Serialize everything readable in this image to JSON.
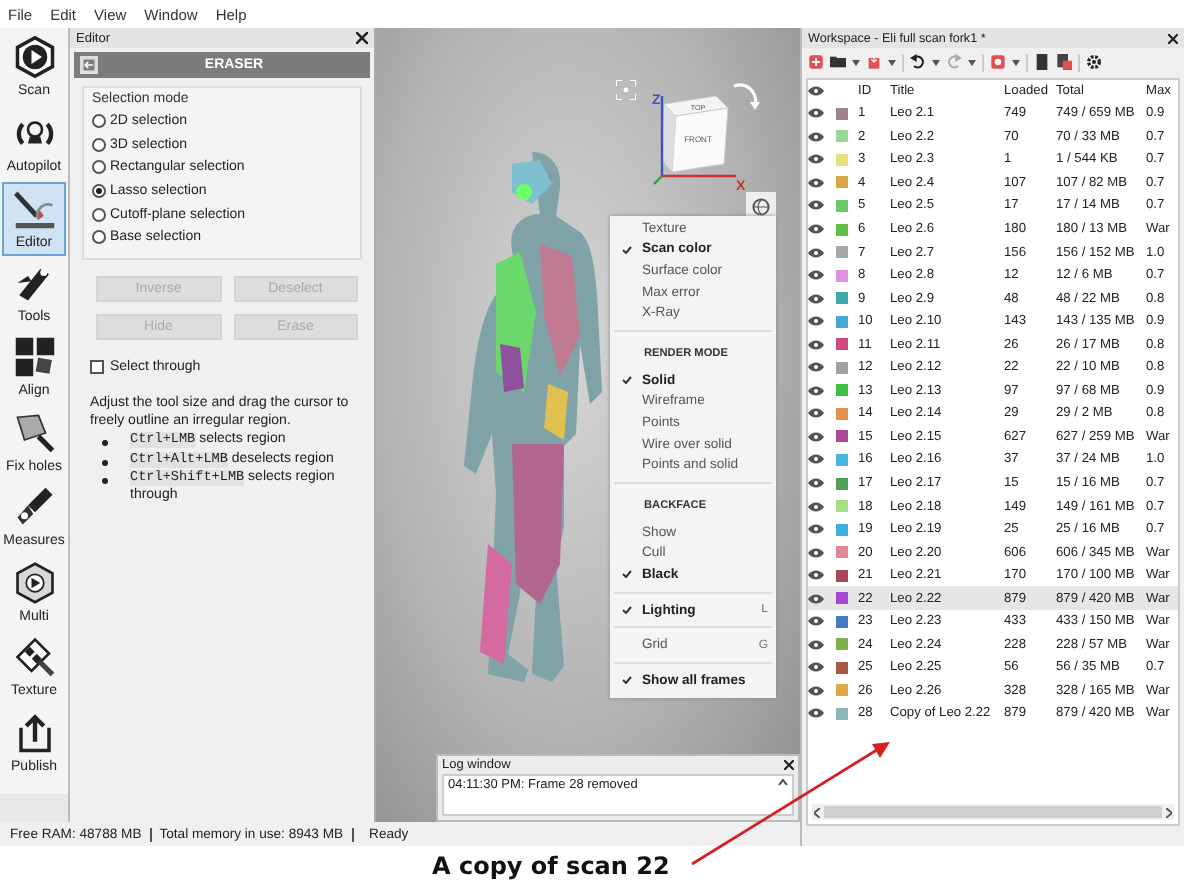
{
  "menu_bar": [
    "File",
    "Edit",
    "View",
    "Window",
    "Help"
  ],
  "tools": [
    {
      "label": "Scan",
      "selected": false
    },
    {
      "label": "Autopilot",
      "selected": false
    },
    {
      "label": "Editor",
      "selected": true
    },
    {
      "label": "Tools",
      "selected": false
    },
    {
      "label": "Align",
      "selected": false
    },
    {
      "label": "Fix holes",
      "selected": false
    },
    {
      "label": "Measures",
      "selected": false
    },
    {
      "label": "Multi",
      "selected": false
    },
    {
      "label": "Texture",
      "selected": false
    },
    {
      "label": "Publish",
      "selected": false
    }
  ],
  "editor": {
    "title": "Editor",
    "header": "ERASER",
    "selection_mode": {
      "title": "Selection mode",
      "options": [
        {
          "label": "2D selection",
          "selected": false
        },
        {
          "label": "3D selection",
          "selected": false
        },
        {
          "label": "Rectangular selection",
          "selected": false
        },
        {
          "label": "Lasso selection",
          "selected": true
        },
        {
          "label": "Cutoff-plane selection",
          "selected": false
        },
        {
          "label": "Base selection",
          "selected": false
        }
      ]
    },
    "buttons": [
      {
        "label": "Inverse",
        "disabled": true
      },
      {
        "label": "Deselect",
        "disabled": true
      },
      {
        "label": "Hide",
        "disabled": true
      },
      {
        "label": "Erase",
        "disabled": true
      }
    ],
    "select_through": {
      "label": "Select through",
      "checked": false
    },
    "description": "Adjust the tool size and drag the cursor to freely outline an irregular region.",
    "shortcuts": [
      {
        "keys": "Ctrl+LMB",
        "text": "selects region"
      },
      {
        "keys": "Ctrl+Alt+LMB",
        "text": "deselects region"
      },
      {
        "keys": "Ctrl+Shift+LMB",
        "text": "selects region through"
      }
    ]
  },
  "viewport": {
    "view_cube": {
      "top": "TOP",
      "front": "FRONT",
      "z_axis": "Z",
      "x_axis": "X"
    },
    "menu": [
      {
        "kind": "item",
        "label": "Texture",
        "checked": false
      },
      {
        "kind": "item",
        "label": "Scan color",
        "checked": true
      },
      {
        "kind": "item",
        "label": "Surface color",
        "checked": false
      },
      {
        "kind": "item",
        "label": "Max error",
        "checked": false
      },
      {
        "kind": "item",
        "label": "X-Ray",
        "checked": false
      },
      {
        "kind": "separator"
      },
      {
        "kind": "header",
        "label": "RENDER MODE"
      },
      {
        "kind": "item",
        "label": "Solid",
        "checked": true
      },
      {
        "kind": "item",
        "label": "Wireframe",
        "checked": false
      },
      {
        "kind": "item",
        "label": "Points",
        "checked": false
      },
      {
        "kind": "item",
        "label": "Wire over solid",
        "checked": false
      },
      {
        "kind": "item",
        "label": "Points and solid",
        "checked": false
      },
      {
        "kind": "separator"
      },
      {
        "kind": "header",
        "label": "BACKFACE"
      },
      {
        "kind": "item",
        "label": "Show",
        "checked": false
      },
      {
        "kind": "item",
        "label": "Cull",
        "checked": false
      },
      {
        "kind": "item",
        "label": "Black",
        "checked": true
      },
      {
        "kind": "separator"
      },
      {
        "kind": "item",
        "label": "Lighting",
        "checked": true,
        "shortcut": "L"
      },
      {
        "kind": "separator"
      },
      {
        "kind": "item",
        "label": "Grid",
        "checked": false,
        "shortcut": "G"
      },
      {
        "kind": "separator"
      },
      {
        "kind": "item",
        "label": "Show all frames",
        "checked": true
      }
    ]
  },
  "log_window": {
    "title": "Log window",
    "lines": [
      "04:11:30 PM: Frame 28 removed"
    ]
  },
  "workspace": {
    "title": "Workspace - Eli full scan fork1 *",
    "columns": [
      "ID",
      "Title",
      "Loaded",
      "Total",
      "Max"
    ],
    "rows": [
      {
        "id": "1",
        "title": "Leo 2.1",
        "loaded": "749",
        "total": "749 / 659 MB",
        "max": "0.9",
        "color": "#a08488",
        "selected": false
      },
      {
        "id": "2",
        "title": "Leo 2.2",
        "loaded": "70",
        "total": "70 / 33 MB",
        "max": "0.7",
        "color": "#98d898",
        "selected": false
      },
      {
        "id": "3",
        "title": "Leo 2.3",
        "loaded": "1",
        "total": "1 / 544 KB",
        "max": "0.7",
        "color": "#e8e080",
        "selected": false
      },
      {
        "id": "4",
        "title": "Leo 2.4",
        "loaded": "107",
        "total": "107 / 82 MB",
        "max": "0.7",
        "color": "#d8a848",
        "selected": false
      },
      {
        "id": "5",
        "title": "Leo 2.5",
        "loaded": "17",
        "total": "17 / 14 MB",
        "max": "0.7",
        "color": "#68c868",
        "selected": false
      },
      {
        "id": "6",
        "title": "Leo 2.6",
        "loaded": "180",
        "total": "180 / 13 MB",
        "max": "War",
        "color": "#60c048",
        "selected": false
      },
      {
        "id": "7",
        "title": "Leo 2.7",
        "loaded": "156",
        "total": "156 / 152 MB",
        "max": "1.0",
        "color": "#a8a8a8",
        "selected": false
      },
      {
        "id": "8",
        "title": "Leo 2.8",
        "loaded": "12",
        "total": "12 / 6 MB",
        "max": "0.7",
        "color": "#e090e0",
        "selected": false
      },
      {
        "id": "9",
        "title": "Leo 2.9",
        "loaded": "48",
        "total": "48 / 22 MB",
        "max": "0.8",
        "color": "#40a8a8",
        "selected": false
      },
      {
        "id": "10",
        "title": "Leo 2.10",
        "loaded": "143",
        "total": "143 / 135 MB",
        "max": "0.9",
        "color": "#48a8d8",
        "selected": false
      },
      {
        "id": "11",
        "title": "Leo 2.11",
        "loaded": "26",
        "total": "26 / 17 MB",
        "max": "0.8",
        "color": "#d04880",
        "selected": false
      },
      {
        "id": "12",
        "title": "Leo 2.12",
        "loaded": "22",
        "total": "22 / 10 MB",
        "max": "0.8",
        "color": "#a0a0a0",
        "selected": false
      },
      {
        "id": "13",
        "title": "Leo 2.13",
        "loaded": "97",
        "total": "97 / 68 MB",
        "max": "0.9",
        "color": "#40c040",
        "selected": false
      },
      {
        "id": "14",
        "title": "Leo 2.14",
        "loaded": "29",
        "total": "29 / 2 MB",
        "max": "0.8",
        "color": "#e09048",
        "selected": false
      },
      {
        "id": "15",
        "title": "Leo 2.15",
        "loaded": "627",
        "total": "627 / 259 MB",
        "max": "War",
        "color": "#b04898",
        "selected": false
      },
      {
        "id": "16",
        "title": "Leo 2.16",
        "loaded": "37",
        "total": "37 / 24 MB",
        "max": "1.0",
        "color": "#48b8e0",
        "selected": false
      },
      {
        "id": "17",
        "title": "Leo 2.17",
        "loaded": "15",
        "total": "15 / 16 MB",
        "max": "0.7",
        "color": "#50a058",
        "selected": false
      },
      {
        "id": "18",
        "title": "Leo 2.18",
        "loaded": "149",
        "total": "149 / 161 MB",
        "max": "0.7",
        "color": "#a8e088",
        "selected": false
      },
      {
        "id": "19",
        "title": "Leo 2.19",
        "loaded": "25",
        "total": "25 / 16 MB",
        "max": "0.7",
        "color": "#40b0e0",
        "selected": false
      },
      {
        "id": "20",
        "title": "Leo 2.20",
        "loaded": "606",
        "total": "606 / 345 MB",
        "max": "War",
        "color": "#e08898",
        "selected": false
      },
      {
        "id": "21",
        "title": "Leo 2.21",
        "loaded": "170",
        "total": "170 / 100 MB",
        "max": "War",
        "color": "#a84858",
        "selected": false
      },
      {
        "id": "22",
        "title": "Leo 2.22",
        "loaded": "879",
        "total": "879 / 420 MB",
        "max": "War",
        "color": "#a848d0",
        "selected": true
      },
      {
        "id": "23",
        "title": "Leo 2.23",
        "loaded": "433",
        "total": "433 / 150 MB",
        "max": "War",
        "color": "#4878c0",
        "selected": false
      },
      {
        "id": "24",
        "title": "Leo 2.24",
        "loaded": "228",
        "total": "228 / 57 MB",
        "max": "War",
        "color": "#80b048",
        "selected": false
      },
      {
        "id": "25",
        "title": "Leo 2.25",
        "loaded": "56",
        "total": "56 / 35 MB",
        "max": "0.7",
        "color": "#a85848",
        "selected": false
      },
      {
        "id": "26",
        "title": "Leo 2.26",
        "loaded": "328",
        "total": "328 / 165 MB",
        "max": "War",
        "color": "#e0a848",
        "selected": false
      },
      {
        "id": "28",
        "title": "Copy of Leo 2.22",
        "loaded": "879",
        "total": "879 / 420 MB",
        "max": "War",
        "color": "#88b8b8",
        "selected": false
      }
    ]
  },
  "status_bar": [
    "Free RAM: 48788 MB",
    "Total memory in use: 8943 MB",
    "Ready"
  ],
  "annotation": {
    "text": "A copy of scan 22"
  }
}
